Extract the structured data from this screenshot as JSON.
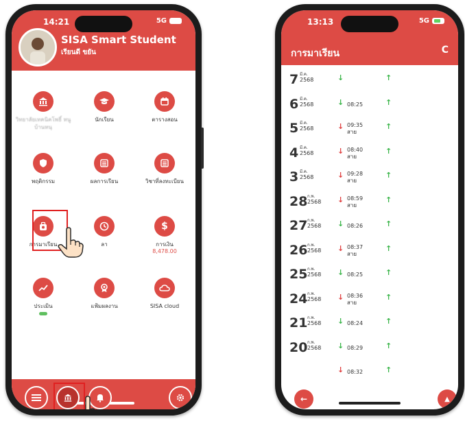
{
  "left_phone": {
    "status": {
      "time": "14:21",
      "signal": "5G"
    },
    "app_title": "SISA Smart Student",
    "user_name": "เรียนดี ขยัน",
    "tiles": [
      {
        "label": "วิทยาลัยเทคนิคโพธิ์ หนูบ้านหนุ",
        "icon": "school-icon"
      },
      {
        "label": "นักเรียน",
        "icon": "graduation-cap-icon"
      },
      {
        "label": "ตารางสอน",
        "icon": "calendar-icon"
      },
      {
        "label": "พฤติกรรม",
        "icon": "shield-icon"
      },
      {
        "label": "ผลการเรียน",
        "icon": "list-icon"
      },
      {
        "label": "วิชาที่ลงทะเบียน",
        "icon": "list-icon"
      },
      {
        "label": "การมาเรียน",
        "icon": "attendance-icon"
      },
      {
        "label": "ลา",
        "icon": "clock-icon"
      },
      {
        "label": "การเงิน",
        "icon": "dollar-icon",
        "amount": "8,478.00"
      },
      {
        "label": "ประเมิน",
        "icon": "trend-icon"
      },
      {
        "label": "แฟ้มผลงาน",
        "icon": "award-icon"
      },
      {
        "label": "SISA cloud",
        "icon": "cloud-icon"
      }
    ]
  },
  "right_phone": {
    "status": {
      "time": "13:13",
      "signal": "5G"
    },
    "title": "การมาเรียน",
    "refresh_glyph": "C",
    "records": [
      {
        "day": "7",
        "month": "มี.ค.",
        "year": "2568",
        "status": "ok",
        "time": "",
        "note": ""
      },
      {
        "day": "6",
        "month": "มี.ค.",
        "year": "2568",
        "status": "ok",
        "time": "08:25",
        "note": ""
      },
      {
        "day": "5",
        "month": "มี.ค.",
        "year": "2568",
        "status": "late",
        "time": "09:35",
        "note": "สาย"
      },
      {
        "day": "4",
        "month": "มี.ค.",
        "year": "2568",
        "status": "late",
        "time": "08:40",
        "note": "สาย"
      },
      {
        "day": "3",
        "month": "มี.ค.",
        "year": "2568",
        "status": "late",
        "time": "09:28",
        "note": "สาย"
      },
      {
        "day": "28",
        "month": "ก.พ.",
        "year": "2568",
        "status": "late",
        "time": "08:59",
        "note": "สาย"
      },
      {
        "day": "27",
        "month": "ก.พ.",
        "year": "2568",
        "status": "ok",
        "time": "08:26",
        "note": ""
      },
      {
        "day": "26",
        "month": "ก.พ.",
        "year": "2568",
        "status": "late",
        "time": "08:37",
        "note": "สาย"
      },
      {
        "day": "25",
        "month": "ก.พ.",
        "year": "2568",
        "status": "ok",
        "time": "08:25",
        "note": ""
      },
      {
        "day": "24",
        "month": "ก.พ.",
        "year": "2568",
        "status": "late",
        "time": "08:36",
        "note": "สาย"
      },
      {
        "day": "21",
        "month": "ก.พ.",
        "year": "2568",
        "status": "ok",
        "time": "08:24",
        "note": ""
      },
      {
        "day": "20",
        "month": "ก.พ.",
        "year": "2568",
        "status": "ok",
        "time": "08:29",
        "note": ""
      },
      {
        "day": "",
        "month": "",
        "year": "",
        "status": "late",
        "time": "08:32",
        "note": ""
      }
    ]
  },
  "colors": {
    "accent": "#dd4b45",
    "ok": "#3bb54a",
    "late": "#e04040",
    "highlight": "#e02020"
  }
}
